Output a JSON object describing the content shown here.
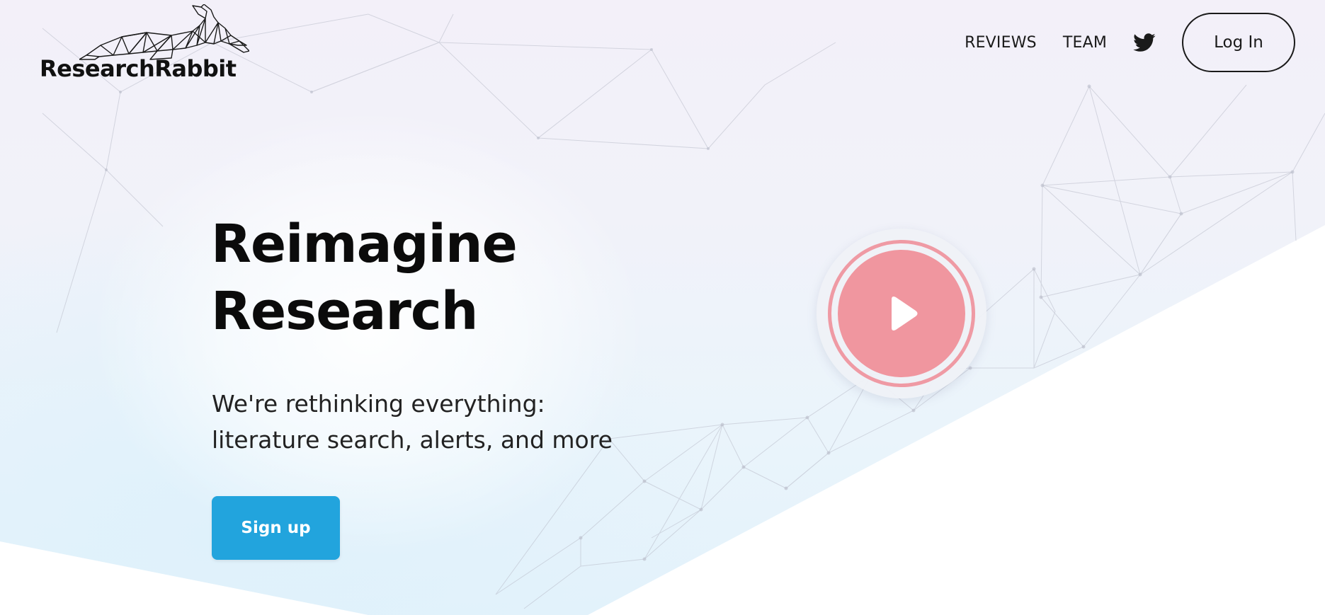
{
  "brand": {
    "name": "ResearchRabbit",
    "logo_icon": "rabbit-logo-icon"
  },
  "nav": {
    "reviews": "REVIEWS",
    "team": "TEAM",
    "twitter_icon": "twitter-icon",
    "login": "Log In"
  },
  "hero": {
    "headline_line1": "Reimagine",
    "headline_line2": "Research",
    "sub_line1": "We're rethinking everything:",
    "sub_line2": "literature search, alerts, and more",
    "signup": "Sign up",
    "play_icon": "play-icon"
  },
  "colors": {
    "accent_blue": "#22a4dd",
    "play_pink": "#f0969f",
    "text_dark": "#0b0b0b"
  }
}
